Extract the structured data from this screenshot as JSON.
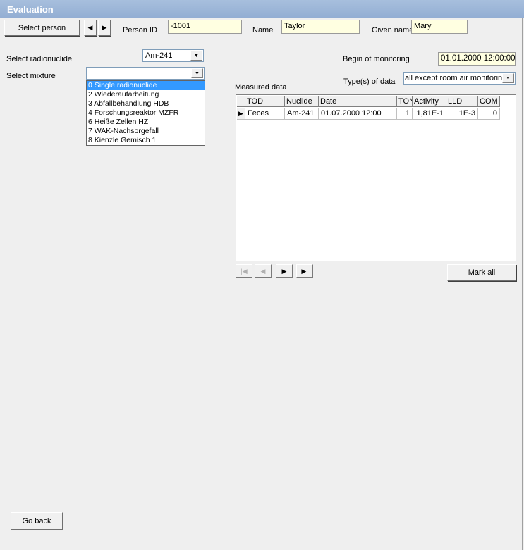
{
  "window": {
    "title": "Evaluation"
  },
  "toolbar": {
    "select_person": "Select person",
    "prev_arrow": "◀",
    "next_arrow": "▶",
    "person_id_label": "Person ID",
    "person_id_value": "-1001",
    "name_label": "Name",
    "name_value": "Taylor",
    "given_name_label": "Given name",
    "given_name_value": "Mary"
  },
  "radionuclide": {
    "label": "Select radionuclide",
    "value": "Am-241"
  },
  "mixture": {
    "label": "Select mixture",
    "value": "",
    "options": [
      "0 Single radionuclide",
      "2 Wiederaufarbeitung",
      "3 Abfallbehandlung HDB",
      "4 Forschungsreaktor MZFR",
      "6 Heiße Zellen HZ",
      "7 WAK-Nachsorgefall",
      "8 Kienzle Gemisch 1"
    ],
    "selected_index": 0
  },
  "monitoring": {
    "label": "Begin of monitoring",
    "value": "01.01.2000 12:00:00"
  },
  "data_type": {
    "label": "Type(s) of data",
    "value": "all except room air monitoring"
  },
  "measured": {
    "label": "Measured data",
    "columns": [
      "TOD",
      "Nuclide",
      "Date",
      "TON",
      "Activity",
      "LLD",
      "COM"
    ],
    "rows": [
      [
        "Feces",
        "Am-241",
        "01.07.2000 12:00",
        "1",
        "1,81E-1",
        "1E-3",
        "0"
      ]
    ]
  },
  "nav": {
    "first": "|◀",
    "prev": "◀",
    "next": "▶",
    "last": "▶|"
  },
  "buttons": {
    "mark_all": "Mark all",
    "go_back": "Go back"
  },
  "colors": {
    "title_bar": "#93aed3",
    "field_bg": "#ffffe1",
    "selected": "#3399ff"
  }
}
